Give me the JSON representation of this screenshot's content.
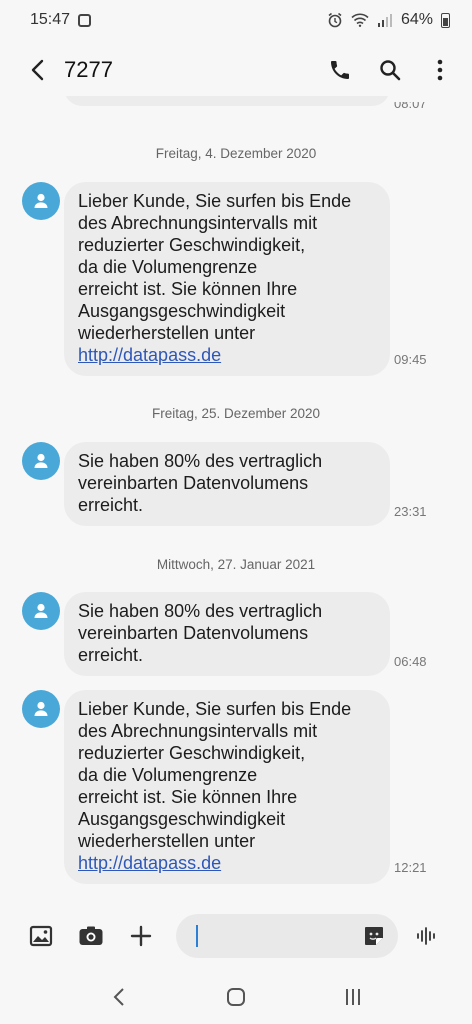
{
  "status_bar": {
    "time": "15:47",
    "battery": "64%"
  },
  "header": {
    "contact": "7277"
  },
  "partial_message": {
    "time": "08:07"
  },
  "threads": [
    {
      "date": "Freitag, 4. Dezember 2020",
      "messages": [
        {
          "lines": [
            "Lieber Kunde, Sie surfen bis Ende",
            "des Abrechnungsintervalls mit",
            "reduzierter Geschwindigkeit,",
            "da die Volumengrenze",
            "erreicht ist. Sie können Ihre",
            "Ausgangsgeschwindigkeit",
            "wiederherstellen unter"
          ],
          "link": "http://datapass.de",
          "time": "09:45"
        }
      ]
    },
    {
      "date": "Freitag, 25. Dezember 2020",
      "messages": [
        {
          "lines": [
            "Sie haben 80% des vertraglich",
            "vereinbarten Datenvolumens",
            "erreicht."
          ],
          "time": "23:31"
        }
      ]
    },
    {
      "date": "Mittwoch, 27. Januar 2021",
      "messages": [
        {
          "lines": [
            "Sie haben 80% des vertraglich",
            "vereinbarten Datenvolumens",
            "erreicht."
          ],
          "time": "06:48"
        },
        {
          "lines": [
            "Lieber Kunde, Sie surfen bis Ende",
            "des Abrechnungsintervalls mit",
            "reduzierter Geschwindigkeit,",
            "da die Volumengrenze",
            "erreicht ist. Sie können Ihre",
            "Ausgangsgeschwindigkeit",
            "wiederherstellen unter"
          ],
          "link": "http://datapass.de",
          "time": "12:21"
        }
      ]
    }
  ],
  "composer": {
    "value": "",
    "placeholder": ""
  },
  "icons": {
    "back": "back-arrow-icon",
    "call": "phone-icon",
    "search": "search-icon",
    "more": "more-vert-icon",
    "gallery": "image-icon",
    "camera": "camera-icon",
    "add": "plus-icon",
    "sticker": "sticker-icon",
    "voice": "voice-wave-icon"
  },
  "colors": {
    "avatar": "#4aa8d8",
    "link": "#2d57b8",
    "bubble": "#ececec"
  }
}
